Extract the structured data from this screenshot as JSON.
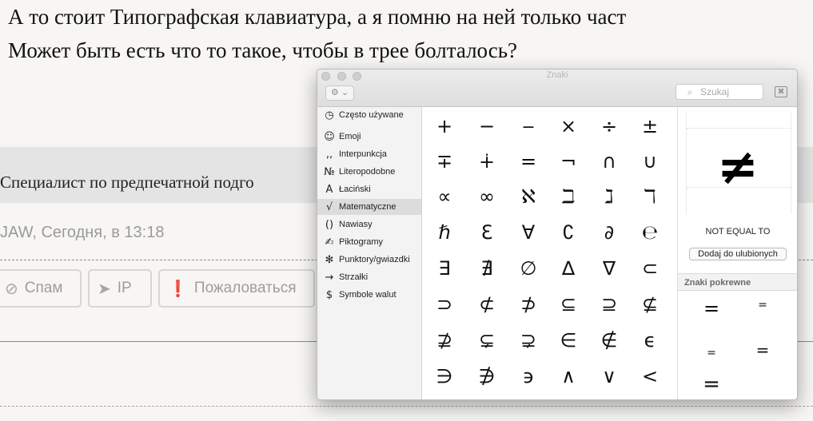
{
  "forum": {
    "line1": "А то стоит Типографская клавиатура, а я помню на ней только част",
    "line2": "Может быть есть что то такое, чтобы в трее болталось?",
    "signature": "Специалист по предпечатной подго",
    "meta": "JAW, Сегодня, в 13:18",
    "buttons": [
      {
        "icon": "⊘",
        "label": "Спам"
      },
      {
        "icon": "➤",
        "label": "IP"
      },
      {
        "icon": "❗",
        "label": "Пожаловаться"
      }
    ]
  },
  "viewer": {
    "title": "Znaki",
    "gear": "⚙ ⌄",
    "search_placeholder": "Szukaj",
    "categories": [
      {
        "icon": "◷",
        "label": "Często używane"
      },
      {
        "icon": "☺",
        "label": "Emoji"
      },
      {
        "icon": ",,",
        "label": "Interpunkcja"
      },
      {
        "icon": "№",
        "label": "Literopodobne"
      },
      {
        "icon": "A",
        "label": "Łaciński"
      },
      {
        "icon": "√",
        "label": "Matematyczne"
      },
      {
        "icon": "()",
        "label": "Nawiasy"
      },
      {
        "icon": "✍",
        "label": "Piktogramy"
      },
      {
        "icon": "✻",
        "label": "Punktory/gwiazdki"
      },
      {
        "icon": "→",
        "label": "Strzałki"
      },
      {
        "icon": "$",
        "label": "Symbole walut"
      }
    ],
    "active_category": "Matematyczne",
    "glyphs": [
      [
        "+",
        "−",
        "‒",
        "×",
        "÷",
        "±"
      ],
      [
        "∓",
        "∔",
        "=",
        "¬",
        "∩",
        "∪"
      ],
      [
        "∝",
        "∞",
        "ℵ",
        "ℶ",
        "ℷ",
        "ℸ"
      ],
      [
        "ℏ",
        "ℇ",
        "∀",
        "∁",
        "∂",
        "℮"
      ],
      [
        "∃",
        "∄",
        "∅",
        "∆",
        "∇",
        "⊂"
      ],
      [
        "⊃",
        "⊄",
        "⊅",
        "⊆",
        "⊇",
        "⊈"
      ],
      [
        "⊉",
        "⊊",
        "⊋",
        "∈",
        "∉",
        "ϵ"
      ],
      [
        "∋",
        "∌",
        "϶",
        "∧",
        "∨",
        "<"
      ]
    ],
    "selected_glyph": "≠",
    "selected_name": "NOT EQUAL TO",
    "favorite_label": "Dodaj do ulubionych",
    "related_title": "Znaki pokrewne",
    "related": [
      "=",
      "=",
      "=",
      "=",
      "="
    ]
  }
}
